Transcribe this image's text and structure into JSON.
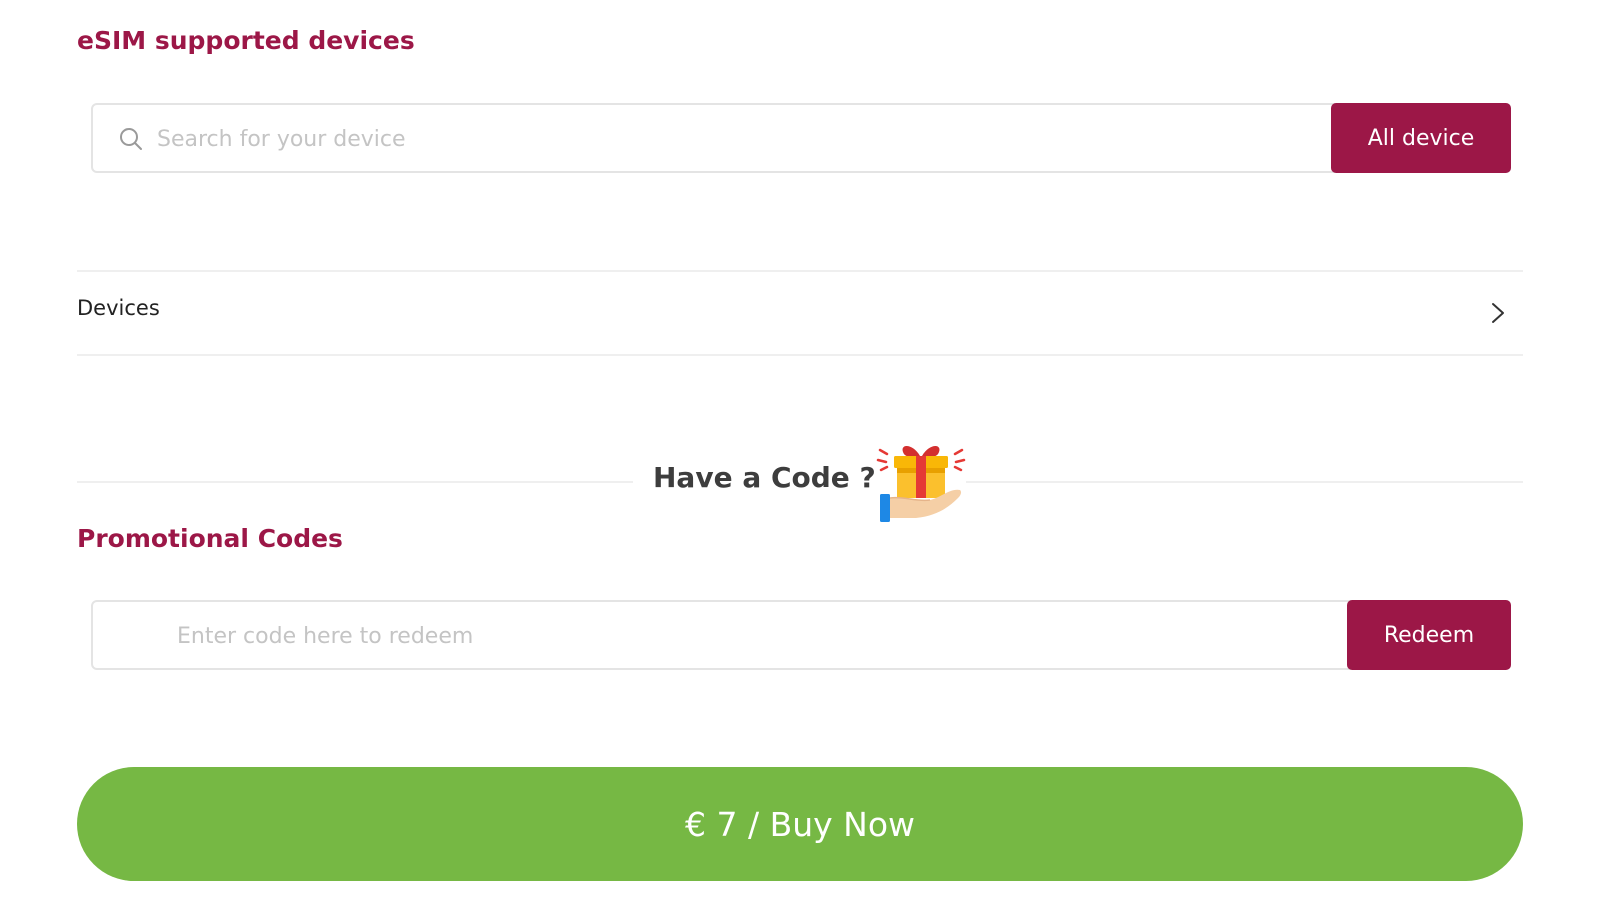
{
  "esim_section": {
    "title": "eSIM supported devices",
    "search_placeholder": "Search for your device",
    "all_device_label": "All device"
  },
  "devices_row": {
    "label": "Devices"
  },
  "code_section": {
    "label": "Have a Code ?"
  },
  "promo_section": {
    "title": "Promotional Codes",
    "input_placeholder": "Enter code here to redeem",
    "redeem_label": "Redeem"
  },
  "buy": {
    "label": "€ 7 / Buy Now"
  },
  "colors": {
    "accent": "#9c1747",
    "buy_button": "#76b844",
    "divider": "#efefef",
    "placeholder": "#c4c4c4"
  },
  "icons": [
    "search-icon",
    "chevron-right-icon",
    "gift-in-hand-icon"
  ]
}
